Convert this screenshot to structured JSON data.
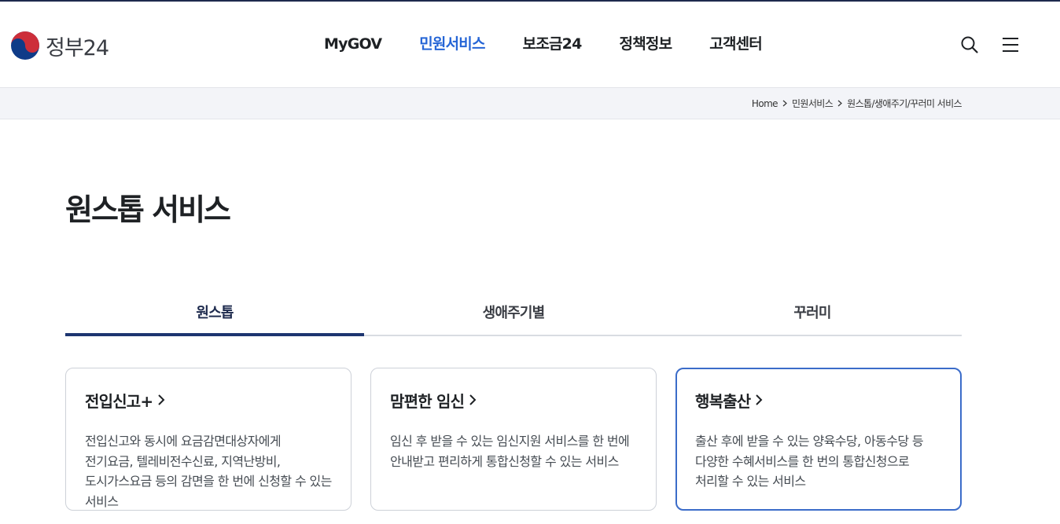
{
  "brand": {
    "logo_text": "정부24",
    "colors": {
      "navy": "#1d2a4d",
      "accent_blue": "#2565d6",
      "emblem_red": "#cd2e3a",
      "emblem_blue": "#0f3b88"
    }
  },
  "nav": {
    "items": [
      {
        "label": "MyGOV",
        "active": false
      },
      {
        "label": "민원서비스",
        "active": true
      },
      {
        "label": "보조금24",
        "active": false
      },
      {
        "label": "정책정보",
        "active": false
      },
      {
        "label": "고객센터",
        "active": false
      }
    ]
  },
  "utility": {
    "search_icon": "search-icon",
    "menu_icon": "hamburger-menu-icon"
  },
  "breadcrumb": [
    "Home",
    "민원서비스",
    "원스톱/생애주기/꾸러미 서비스"
  ],
  "page": {
    "title": "원스톱 서비스"
  },
  "tabs": [
    {
      "label": "원스톱",
      "active": true
    },
    {
      "label": "생애주기별",
      "active": false
    },
    {
      "label": "꾸러미",
      "active": false
    }
  ],
  "cards": [
    {
      "title": "전입신고+",
      "desc": "전입신고와 동시에 요금감면대상자에게 전기요금, 텔레비전수신료, 지역난방비, 도시가스요금 등의 감면을 한 번에 신청할 수 있는 서비스"
    },
    {
      "title": "맘편한 임신",
      "desc": "임신 후 받을 수 있는 임신지원 서비스를 한 번에 안내받고 편리하게 통합신청할 수 있는 서비스"
    },
    {
      "title": "행복출산",
      "desc": "출산 후에 받을 수 있는 양육수당, 아동수당 등 다양한 수혜서비스를 한 번의 통합신청으로 처리할 수 있는 서비스"
    }
  ]
}
